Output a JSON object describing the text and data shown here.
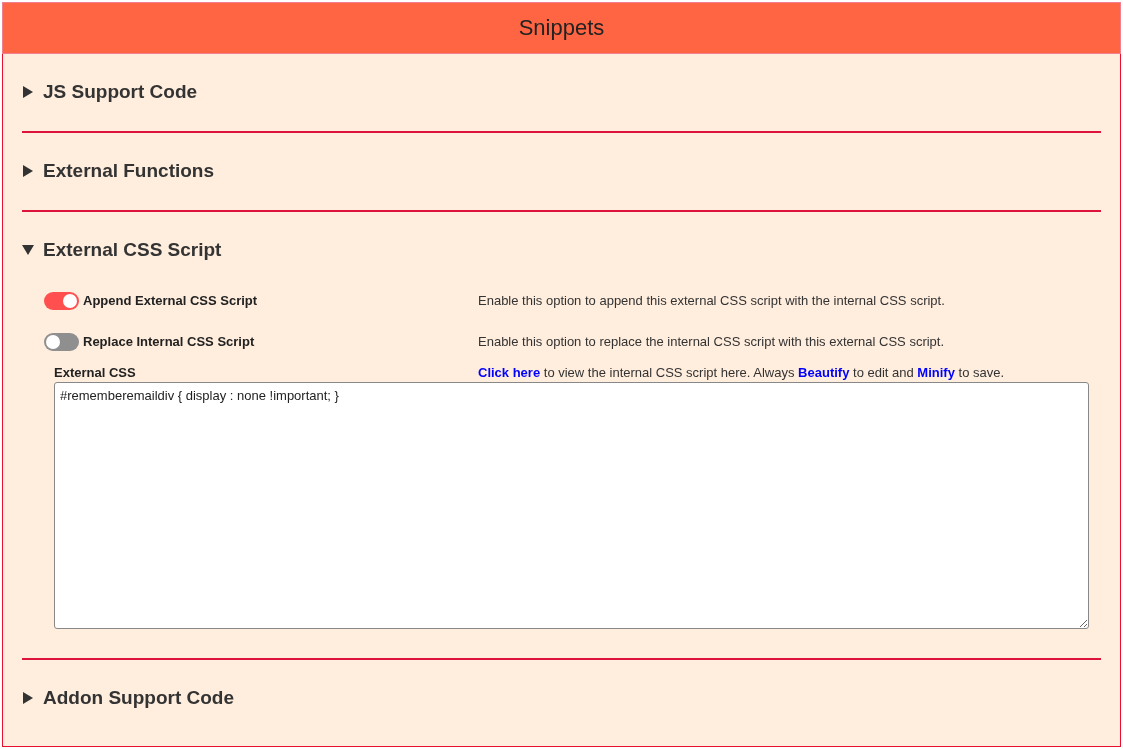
{
  "title": "Snippets",
  "sections": [
    {
      "title": "JS Support Code",
      "expanded": false
    },
    {
      "title": "External Functions",
      "expanded": false
    },
    {
      "title": "External CSS Script",
      "expanded": true,
      "options": [
        {
          "label": "Append External CSS Script",
          "on": true,
          "description": "Enable this option to append this external CSS script with the internal CSS script."
        },
        {
          "label": "Replace Internal CSS Script",
          "on": false,
          "description": "Enable this option to replace the internal CSS script with this external CSS script."
        }
      ],
      "editor": {
        "label": "External CSS",
        "help": [
          {
            "kind": "link",
            "text": "Click here"
          },
          {
            "kind": "text",
            "text": " to view the internal CSS script here. Always "
          },
          {
            "kind": "link",
            "text": "Beautify"
          },
          {
            "kind": "text",
            "text": " to edit and "
          },
          {
            "kind": "link",
            "text": "Minify"
          },
          {
            "kind": "text",
            "text": " to save."
          }
        ],
        "value": "#rememberemaildiv { display : none !important; }"
      }
    },
    {
      "title": "Addon Support Code",
      "expanded": false
    }
  ]
}
